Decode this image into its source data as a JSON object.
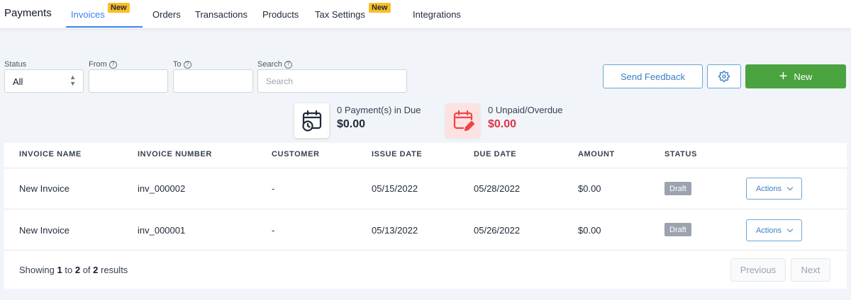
{
  "nav": {
    "brand": "Payments",
    "tabs": [
      {
        "label": "Invoices",
        "badge": "New",
        "active": true
      },
      {
        "label": "Orders"
      },
      {
        "label": "Transactions"
      },
      {
        "label": "Products"
      },
      {
        "label": "Tax Settings",
        "badge": "New"
      },
      {
        "label": "Integrations"
      }
    ]
  },
  "filters": {
    "status_label": "Status",
    "status_value": "All",
    "from_label": "From",
    "to_label": "To",
    "search_label": "Search",
    "search_placeholder": "Search",
    "help_glyph": "?"
  },
  "actions": {
    "feedback_label": "Send Feedback",
    "settings_icon": "gear-icon",
    "new_label": "New"
  },
  "stats": {
    "due": {
      "count_text": "0  Payment(s) in Due",
      "amount": "$0.00",
      "icon": "calendar-clock-icon"
    },
    "overdue": {
      "count_text": "0  Unpaid/Overdue",
      "amount": "$0.00",
      "icon": "calendar-edit-icon"
    }
  },
  "table": {
    "headers": [
      "INVOICE NAME",
      "INVOICE NUMBER",
      "CUSTOMER",
      "ISSUE DATE",
      "DUE DATE",
      "AMOUNT",
      "STATUS"
    ],
    "rows": [
      {
        "name": "New Invoice",
        "number": "inv_000002",
        "customer": "-",
        "issue_date": "05/15/2022",
        "due_date": "05/28/2022",
        "amount": "$0.00",
        "status": "Draft",
        "actions_label": "Actions"
      },
      {
        "name": "New Invoice",
        "number": "inv_000001",
        "customer": "-",
        "issue_date": "05/13/2022",
        "due_date": "05/26/2022",
        "amount": "$0.00",
        "status": "Draft",
        "actions_label": "Actions"
      }
    ]
  },
  "footer": {
    "showing_prefix": "Showing",
    "from": "1",
    "to_word": "to",
    "to": "2",
    "of_word": "of",
    "total": "2",
    "results_word": "results",
    "previous_label": "Previous",
    "next_label": "Next"
  },
  "colors": {
    "accent": "#3b82f6",
    "primary_green": "#4aa33f",
    "overdue_red": "#dc3545",
    "badge_yellow": "#fbbf24",
    "draft_gray": "#9ca3af"
  }
}
